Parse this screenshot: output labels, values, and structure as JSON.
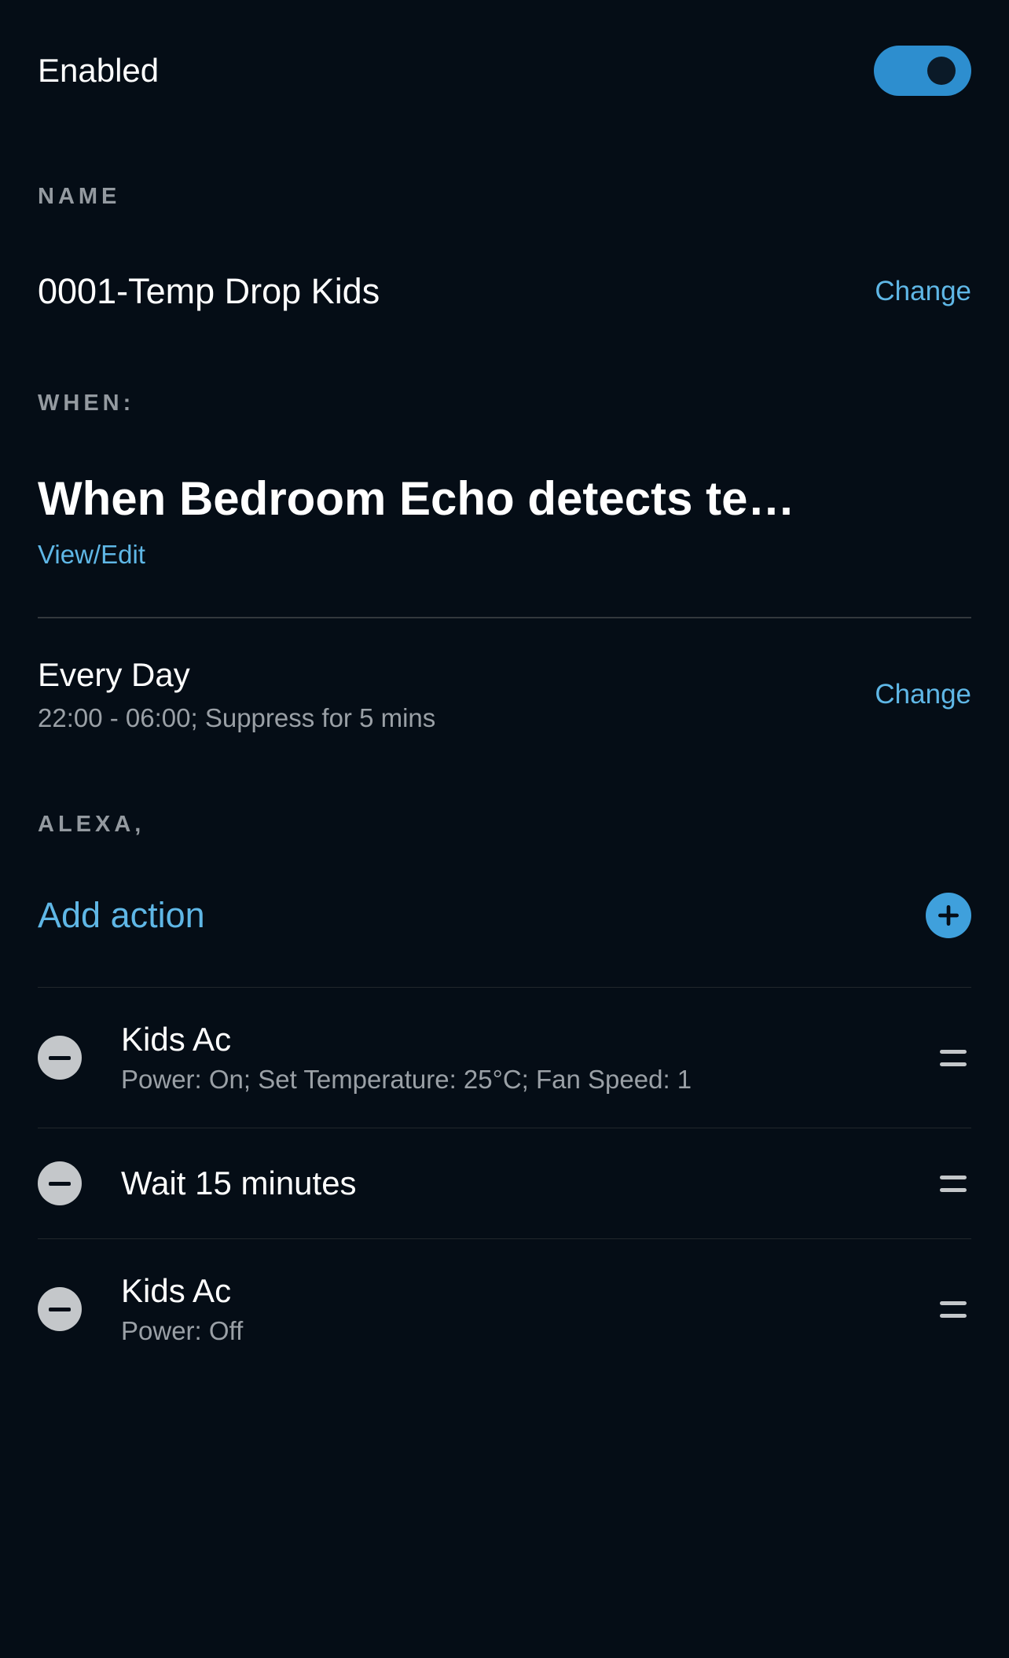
{
  "enabled_label": "Enabled",
  "enabled": true,
  "sections": {
    "name_header": "NAME",
    "when_header": "WHEN:",
    "alexa_header": "ALEXA,"
  },
  "name": {
    "value": "0001-Temp Drop Kids",
    "change_label": "Change"
  },
  "trigger": {
    "title": "When Bedroom Echo detects te…",
    "view_edit_label": "View/Edit"
  },
  "schedule": {
    "title": "Every Day",
    "detail": "22:00 - 06:00; Suppress for 5 mins",
    "change_label": "Change"
  },
  "add_action_label": "Add action",
  "actions": [
    {
      "title": "Kids Ac",
      "detail": "Power: On; Set Temperature: 25°C; Fan Speed: 1"
    },
    {
      "title": "Wait 15 minutes",
      "detail": ""
    },
    {
      "title": "Kids Ac",
      "detail": "Power: Off"
    }
  ],
  "colors": {
    "accent": "#3fa0dc",
    "link": "#5fb7e6",
    "bg": "#050d16",
    "muted": "#9aa0a6"
  }
}
